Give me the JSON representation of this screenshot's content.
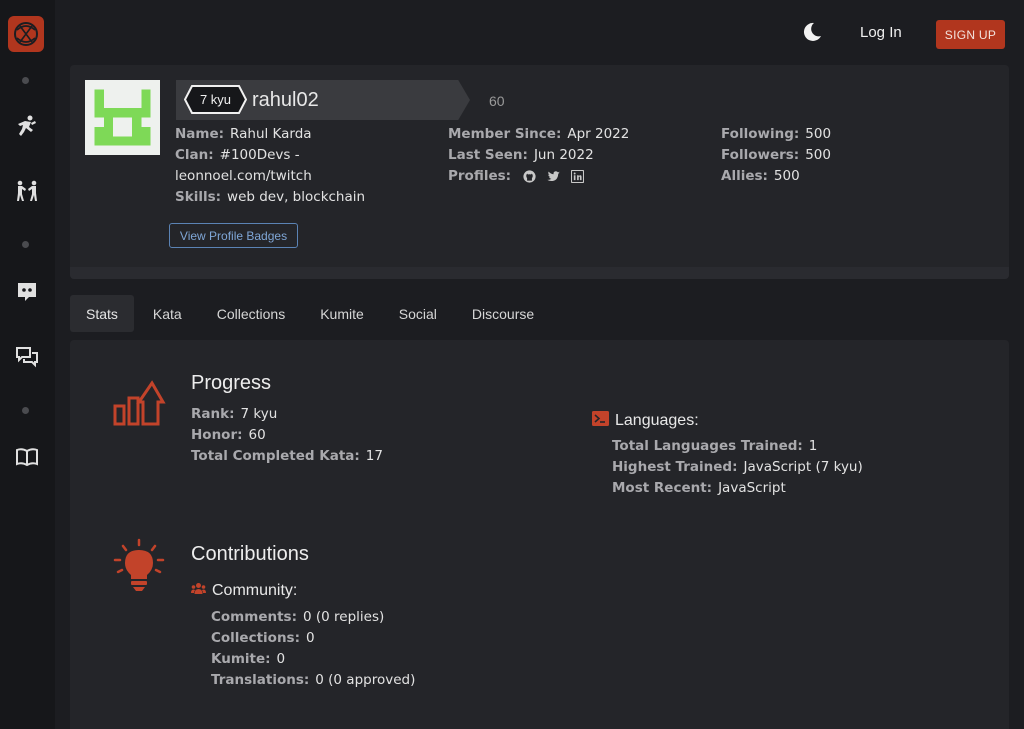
{
  "nav": {
    "login": "Log In",
    "signup": "SIGN UP"
  },
  "profile": {
    "rank": "7 kyu",
    "username": "rahul02",
    "honor": "60",
    "name_label": "Name:",
    "name": "Rahul Karda",
    "clan_label": "Clan:",
    "clan_line1": "#100Devs -",
    "clan_line2": "leonnoel.com/twitch",
    "skills_label": "Skills:",
    "skills": "web dev, blockchain",
    "member_since_label": "Member Since:",
    "member_since": "Apr 2022",
    "last_seen_label": "Last Seen:",
    "last_seen": "Jun 2022",
    "profiles_label": "Profiles:",
    "following_label": "Following:",
    "following": "500",
    "followers_label": "Followers:",
    "followers": "500",
    "allies_label": "Allies:",
    "allies": "500",
    "badges_button": "View Profile Badges"
  },
  "tabs": [
    "Stats",
    "Kata",
    "Collections",
    "Kumite",
    "Social",
    "Discourse"
  ],
  "progress": {
    "title": "Progress",
    "rank_label": "Rank:",
    "rank": "7 kyu",
    "honor_label": "Honor:",
    "honor": "60",
    "completed_label": "Total Completed Kata:",
    "completed": "17"
  },
  "languages": {
    "title": "Languages:",
    "trained_label": "Total Languages Trained:",
    "trained": "1",
    "highest_label": "Highest Trained:",
    "highest": "JavaScript (7 kyu)",
    "recent_label": "Most Recent:",
    "recent": "JavaScript"
  },
  "contributions": {
    "title": "Contributions",
    "community_title": "Community:",
    "comments_label": "Comments:",
    "comments": "0 (0 replies)",
    "collections_label": "Collections:",
    "collections": "0",
    "kumite_label": "Kumite:",
    "kumite": "0",
    "translations_label": "Translations:",
    "translations": "0 (0 approved)"
  },
  "colors": {
    "accent": "#b1361e",
    "background": "#1c1d21",
    "panel": "#242529",
    "link": "#7fa6d6",
    "avatar_green": "#7ed957"
  },
  "icons": [
    "codewars-logo-icon",
    "training-icon",
    "kumite-fight-icon",
    "discord-icon",
    "discussion-icon",
    "docs-book-icon",
    "moon-icon",
    "github-icon",
    "twitter-icon",
    "linkedin-icon",
    "progress-chart-icon",
    "terminal-icon",
    "lightbulb-icon",
    "community-users-icon"
  ]
}
